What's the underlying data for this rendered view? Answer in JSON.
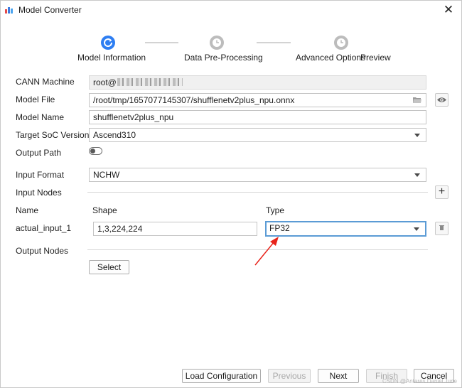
{
  "window": {
    "title": "Model Converter",
    "close_glyph": "✕",
    "icon": "app-logo-icon"
  },
  "steps": [
    {
      "label": "Model Information",
      "state": "active"
    },
    {
      "label": "Data Pre-Processing",
      "state": "pending"
    },
    {
      "label": "Advanced Options",
      "state": "pending"
    },
    {
      "label": "Preview",
      "state": "pending"
    }
  ],
  "form": {
    "cann_machine": {
      "label": "CANN Machine",
      "value": "root@"
    },
    "model_file": {
      "label": "Model File",
      "value": "/root/tmp/1657077145307/shufflenetv2plus_npu.onnx"
    },
    "model_name": {
      "label": "Model Name",
      "value": "shufflenetv2plus_npu"
    },
    "target_soc": {
      "label": "Target SoC Version",
      "value": "Ascend310"
    },
    "output_path": {
      "label": "Output Path",
      "enabled": false
    },
    "input_format": {
      "label": "Input Format",
      "value": "NCHW"
    },
    "input_nodes": {
      "label": "Input Nodes",
      "add_glyph": "+"
    },
    "columns": {
      "name": "Name",
      "shape": "Shape",
      "type": "Type"
    },
    "nodes": [
      {
        "name": "actual_input_1",
        "shape": "1,3,224,224",
        "type": "FP32"
      }
    ],
    "output_nodes": {
      "label": "Output Nodes",
      "select_label": "Select"
    }
  },
  "footer": {
    "load": "Load Configuration",
    "previous": "Previous",
    "next": "Next",
    "finish": "Finish",
    "cancel": "Cancel"
  },
  "colors": {
    "accent": "#2e7ef2",
    "annotation_arrow": "#e8231a",
    "focus_border": "#5b9bd5"
  },
  "watermark": "CSDN @Antares Daniel June"
}
